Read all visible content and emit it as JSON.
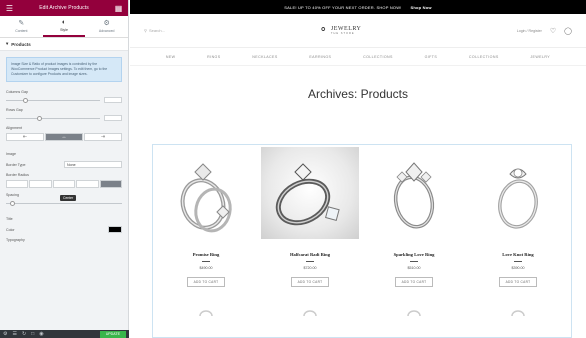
{
  "editor": {
    "header_title": "Edit Archive Products",
    "tabs": [
      {
        "label": "Content"
      },
      {
        "label": "Style"
      },
      {
        "label": "Advanced"
      }
    ],
    "section_title": "Products",
    "notice": "Image Size & Ratio of product images is controlled by the WooCommerce Product Images settings. To edit them, go to the Customizer to configure Products and image sizes.",
    "controls": {
      "column_gap": {
        "label": "Columns Gap",
        "value": "",
        "fill": 0.2
      },
      "rows_gap": {
        "label": "Rows Gap",
        "value": "",
        "fill": 0.35
      },
      "alignment": {
        "label": "Alignment",
        "options": [
          "left",
          "center",
          "right"
        ],
        "tooltip": "Center"
      },
      "image_heading": "Image",
      "border_type": {
        "label": "Border Type",
        "value": "None"
      },
      "border_radius": {
        "label": "Border Radius"
      },
      "spacing": {
        "label": "Spacing",
        "fill": 0.05
      },
      "title_heading": "Title",
      "color": {
        "label": "Color",
        "value": "#000000"
      },
      "typography": {
        "label": "Typography"
      }
    },
    "footer": {
      "update_label": "UPDATE"
    }
  },
  "site": {
    "announcement": "SALE! UP TO 40% OFF YOUR NEXT ORDER. SHOP NOW!",
    "announcement_cta": "Shop Now",
    "search_placeholder": "Search...",
    "brand": "JEWELRY",
    "brand_sub": "THE STORE",
    "account_label": "Login / Register",
    "nav": [
      "NEW",
      "RINGS",
      "NECKLACES",
      "EARRINGS",
      "COLLECTIONS",
      "GIFTS",
      "COLLECTIONS",
      "JEWELRY"
    ],
    "page_title": "Archives: Products",
    "products": [
      {
        "name": "Promise Ring",
        "price": "$490.00",
        "button": "ADD TO CART"
      },
      {
        "name": "Halfcarat Radi Ring",
        "price": "$720.00",
        "button": "ADD TO CART"
      },
      {
        "name": "Sparkling Love Ring",
        "price": "$510.00",
        "button": "ADD TO CART"
      },
      {
        "name": "Love Knot Ring",
        "price": "$390.00",
        "button": "ADD TO CART"
      }
    ]
  },
  "colors": {
    "accent": "#93003c",
    "update": "#39b54a"
  }
}
